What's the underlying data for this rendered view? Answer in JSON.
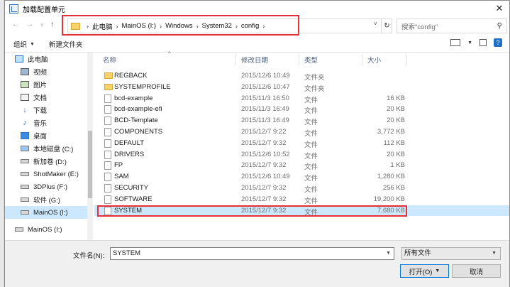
{
  "window": {
    "title": "加载配置单元",
    "close_glyph": "✕"
  },
  "nav": {
    "back": "←",
    "forward": "→",
    "up_caret": "˅",
    "up": "↑"
  },
  "address": {
    "segments": [
      "此电脑",
      "MainOS (I:)",
      "Windows",
      "System32",
      "config"
    ],
    "separator": "›",
    "refresh": "↻"
  },
  "search": {
    "placeholder": "搜索\"config\"",
    "icon": "search-icon"
  },
  "toolbar": {
    "organize": "组织",
    "new_folder": "新建文件夹",
    "help": "?"
  },
  "sidebar": {
    "items": [
      {
        "label": "此电脑",
        "icon": "computer-icon"
      },
      {
        "label": "视频",
        "icon": "video-icon"
      },
      {
        "label": "图片",
        "icon": "pictures-icon"
      },
      {
        "label": "文档",
        "icon": "documents-icon"
      },
      {
        "label": "下载",
        "icon": "download-icon"
      },
      {
        "label": "音乐",
        "icon": "music-icon"
      },
      {
        "label": "桌面",
        "icon": "desktop-icon"
      },
      {
        "label": "本地磁盘 (C:)",
        "icon": "drive-icon"
      },
      {
        "label": "新加卷 (D:)",
        "icon": "drive-icon"
      },
      {
        "label": "ShotMaker (E:)",
        "icon": "drive-icon"
      },
      {
        "label": "3DPlus (F:)",
        "icon": "drive-icon"
      },
      {
        "label": "软件 (G:)",
        "icon": "drive-icon"
      },
      {
        "label": "MainOS (I:)",
        "icon": "drive-icon"
      },
      {
        "label": "MainOS (I:)",
        "icon": "drive-icon"
      }
    ]
  },
  "columns": {
    "name": "名称",
    "date": "修改日期",
    "type": "类型",
    "size": "大小"
  },
  "files": [
    {
      "name": "REGBACK",
      "date": "2015/12/6 10:49",
      "type": "文件夹",
      "size": "",
      "kind": "folder"
    },
    {
      "name": "SYSTEMPROFILE",
      "date": "2015/12/6 10:47",
      "type": "文件夹",
      "size": "",
      "kind": "folder"
    },
    {
      "name": "bcd-example",
      "date": "2015/11/3 16:50",
      "type": "文件",
      "size": "16 KB",
      "kind": "file"
    },
    {
      "name": "bcd-example-efi",
      "date": "2015/11/3 16:49",
      "type": "文件",
      "size": "20 KB",
      "kind": "file"
    },
    {
      "name": "BCD-Template",
      "date": "2015/11/3 16:49",
      "type": "文件",
      "size": "20 KB",
      "kind": "file"
    },
    {
      "name": "COMPONENTS",
      "date": "2015/12/7 9:22",
      "type": "文件",
      "size": "3,772 KB",
      "kind": "file"
    },
    {
      "name": "DEFAULT",
      "date": "2015/12/7 9:32",
      "type": "文件",
      "size": "112 KB",
      "kind": "file"
    },
    {
      "name": "DRIVERS",
      "date": "2015/12/6 10:52",
      "type": "文件",
      "size": "20 KB",
      "kind": "file"
    },
    {
      "name": "FP",
      "date": "2015/12/7 9:32",
      "type": "文件",
      "size": "1 KB",
      "kind": "file"
    },
    {
      "name": "SAM",
      "date": "2015/12/6 10:49",
      "type": "文件",
      "size": "1,280 KB",
      "kind": "file"
    },
    {
      "name": "SECURITY",
      "date": "2015/12/7 9:32",
      "type": "文件",
      "size": "256 KB",
      "kind": "file"
    },
    {
      "name": "SOFTWARE",
      "date": "2015/12/7 9:32",
      "type": "文件",
      "size": "19,200 KB",
      "kind": "file"
    },
    {
      "name": "SYSTEM",
      "date": "2015/12/7 9:32",
      "type": "文件",
      "size": "7,680 KB",
      "kind": "file"
    }
  ],
  "selected_file": "SYSTEM",
  "bottom": {
    "filename_label": "文件名(N):",
    "filename_value": "SYSTEM",
    "filter_value": "所有文件",
    "open_label": "打开(O)",
    "cancel_label": "取消"
  },
  "colors": {
    "highlight_box": "#e5303a",
    "selection": "#cce8ff",
    "folder": "#f7d26a",
    "accent": "#0078d7"
  }
}
